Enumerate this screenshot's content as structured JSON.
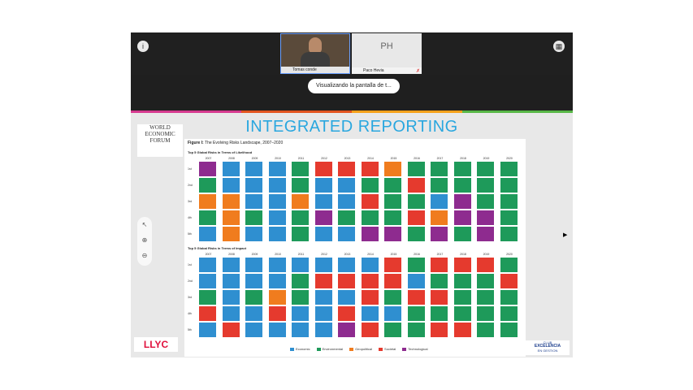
{
  "meeting": {
    "participants": [
      {
        "name": "Tomas conde"
      },
      {
        "name": "Paco Hevia",
        "initials": "PH"
      }
    ],
    "screen_share_tooltip": "Visualizando la pantalla de t..."
  },
  "slide": {
    "title": "INTEGRATED REPORTING",
    "wef_logo": [
      "WORLD",
      "ECONOMIC",
      "FORUM"
    ],
    "llyc_logo": "LLYC",
    "club_logo": [
      "CLUB",
      "EXCELENCIA",
      "EN GESTION"
    ],
    "figure": {
      "caption_bold": "Figure I:",
      "caption": "The Evolving Risks Landscape, 2007–2020",
      "likelihood_title": "Top 5 Global Risks in Terms of Likelihood",
      "impact_title": "Top 5 Global Risks in Terms of Impact",
      "years": [
        "2007",
        "2008",
        "2009",
        "2010",
        "2011",
        "2012",
        "2013",
        "2014",
        "2015",
        "2016",
        "2017",
        "2018",
        "2019",
        "2020"
      ],
      "ranks": [
        "1st",
        "2nd",
        "3rd",
        "4th",
        "5th"
      ],
      "likelihood_grid": [
        [
          "T",
          "E",
          "E",
          "E",
          "Env",
          "S",
          "S",
          "S",
          "G",
          "Env",
          "Env",
          "Env",
          "Env",
          "Env"
        ],
        [
          "Env",
          "E",
          "E",
          "E",
          "Env",
          "E",
          "E",
          "Env",
          "Env",
          "S",
          "Env",
          "Env",
          "Env",
          "Env"
        ],
        [
          "G",
          "G",
          "E",
          "E",
          "G",
          "E",
          "E",
          "S",
          "Env",
          "Env",
          "E",
          "T",
          "Env",
          "Env"
        ],
        [
          "Env",
          "G",
          "Env",
          "E",
          "Env",
          "T",
          "Env",
          "Env",
          "Env",
          "S",
          "G",
          "T",
          "T",
          "Env"
        ],
        [
          "E",
          "G",
          "E",
          "E",
          "Env",
          "E",
          "E",
          "T",
          "T",
          "Env",
          "T",
          "Env",
          "T",
          "Env"
        ]
      ],
      "impact_grid": [
        [
          "E",
          "E",
          "E",
          "E",
          "E",
          "E",
          "E",
          "E",
          "S",
          "Env",
          "S",
          "S",
          "S",
          "Env"
        ],
        [
          "E",
          "E",
          "E",
          "E",
          "Env",
          "S",
          "S",
          "S",
          "S",
          "E",
          "Env",
          "Env",
          "Env",
          "S"
        ],
        [
          "Env",
          "E",
          "Env",
          "G",
          "Env",
          "E",
          "E",
          "S",
          "Env",
          "S",
          "S",
          "Env",
          "Env",
          "Env"
        ],
        [
          "S",
          "E",
          "E",
          "S",
          "E",
          "E",
          "S",
          "E",
          "E",
          "Env",
          "Env",
          "Env",
          "Env",
          "Env"
        ],
        [
          "E",
          "S",
          "E",
          "E",
          "E",
          "E",
          "T",
          "S",
          "Env",
          "Env",
          "S",
          "S",
          "Env",
          "Env"
        ]
      ],
      "legend": [
        {
          "key": "E",
          "label": "Economic",
          "color": "#2f8fd0"
        },
        {
          "key": "Env",
          "label": "Environmental",
          "color": "#1e9a5a"
        },
        {
          "key": "G",
          "label": "Geopolitical",
          "color": "#f07c1e"
        },
        {
          "key": "S",
          "label": "Societal",
          "color": "#e53a2e"
        },
        {
          "key": "T",
          "label": "Technological",
          "color": "#8e2b8f"
        }
      ]
    }
  },
  "accent_colors": {
    "stripe": [
      "#d63a8f",
      "#e3541f",
      "#f6a11a",
      "#58b847"
    ]
  }
}
